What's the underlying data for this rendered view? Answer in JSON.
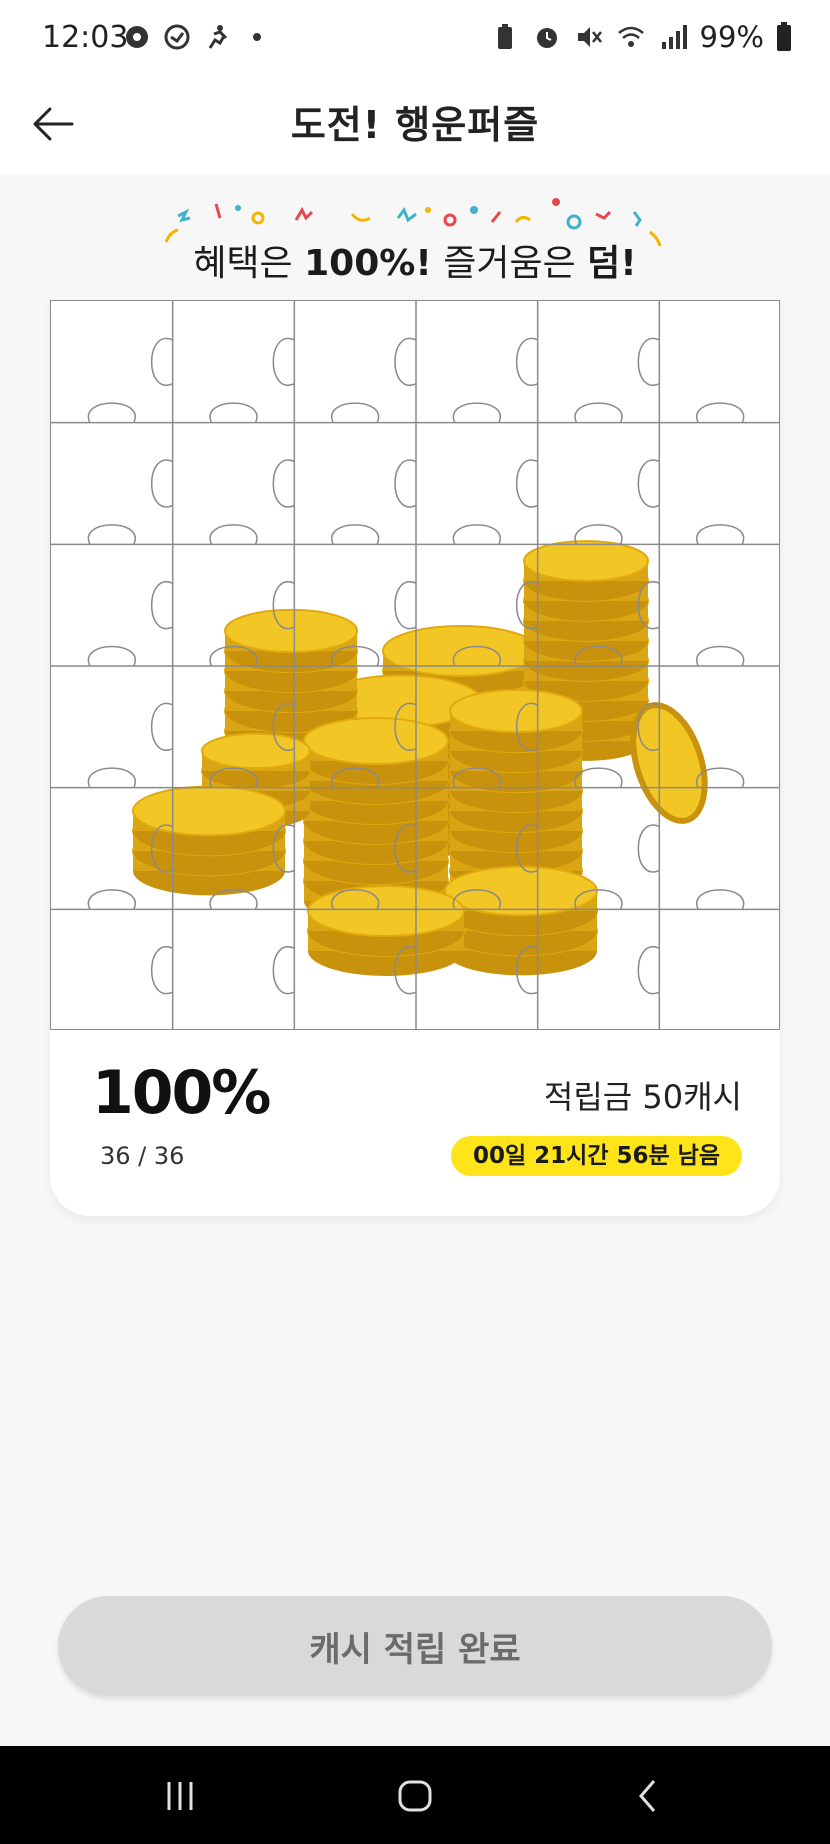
{
  "status_bar": {
    "time": "12:03",
    "battery": "99%"
  },
  "header": {
    "title": "도전! 행운퍼즐"
  },
  "banner": {
    "part1": "혜택은 ",
    "part2": "100%!",
    "part3": " 즐거움은 ",
    "part4": "덤!"
  },
  "progress": {
    "percent_text": "100%",
    "count_text": "36 / 36",
    "pieces_done": 36,
    "pieces_total": 36
  },
  "reward": {
    "label": "적립금 50캐시"
  },
  "timer": {
    "label": "00일 21시간 56분 남음"
  },
  "action": {
    "complete_label": "캐시 적립 완료"
  },
  "colors": {
    "accent_yellow": "#ffe419",
    "coin_gold": "#f2c624",
    "disabled_button": "#d9d9d9"
  }
}
